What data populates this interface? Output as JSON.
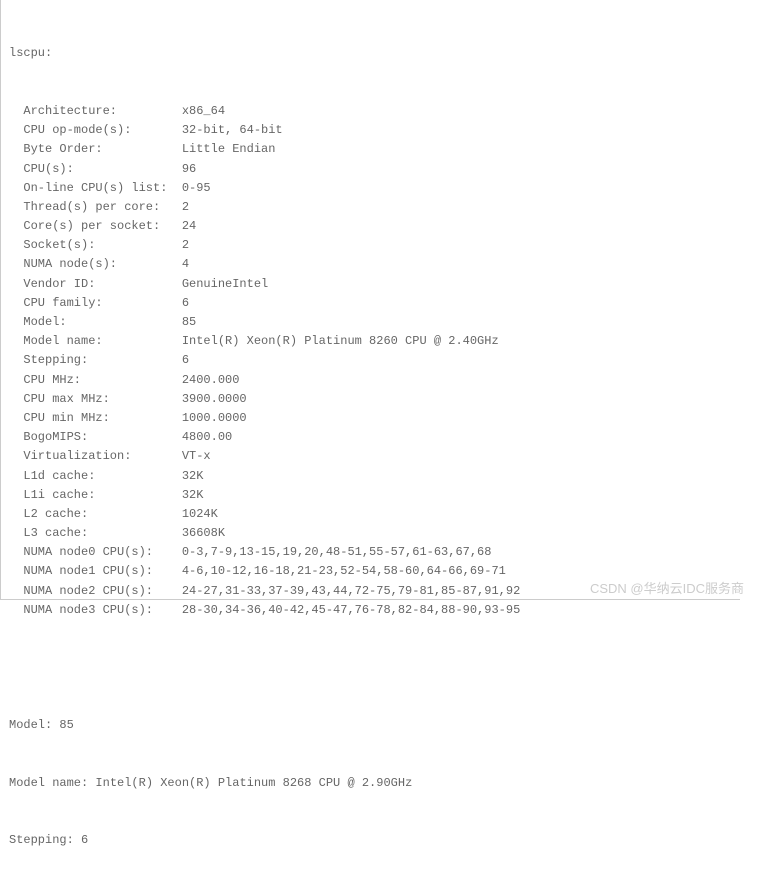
{
  "header": "lscpu:",
  "rows": [
    {
      "label": "Architecture:",
      "value": "x86_64"
    },
    {
      "label": "CPU op-mode(s):",
      "value": "32-bit, 64-bit"
    },
    {
      "label": "Byte Order:",
      "value": "Little Endian"
    },
    {
      "label": "CPU(s):",
      "value": "96"
    },
    {
      "label": "On-line CPU(s) list:",
      "value": "0-95"
    },
    {
      "label": "Thread(s) per core:",
      "value": "2"
    },
    {
      "label": "Core(s) per socket:",
      "value": "24"
    },
    {
      "label": "Socket(s):",
      "value": "2"
    },
    {
      "label": "NUMA node(s):",
      "value": "4"
    },
    {
      "label": "Vendor ID:",
      "value": "GenuineIntel"
    },
    {
      "label": "CPU family:",
      "value": "6"
    },
    {
      "label": "Model:",
      "value": "85"
    },
    {
      "label": "Model name:",
      "value": "Intel(R) Xeon(R) Platinum 8260 CPU @ 2.40GHz"
    },
    {
      "label": "Stepping:",
      "value": "6"
    },
    {
      "label": "CPU MHz:",
      "value": "2400.000"
    },
    {
      "label": "CPU max MHz:",
      "value": "3900.0000"
    },
    {
      "label": "CPU min MHz:",
      "value": "1000.0000"
    },
    {
      "label": "BogoMIPS:",
      "value": "4800.00"
    },
    {
      "label": "Virtualization:",
      "value": "VT-x"
    },
    {
      "label": "L1d cache:",
      "value": "32K"
    },
    {
      "label": "L1i cache:",
      "value": "32K"
    },
    {
      "label": "L2 cache:",
      "value": "1024K"
    },
    {
      "label": "L3 cache:",
      "value": "36608K"
    },
    {
      "label": "NUMA node0 CPU(s):",
      "value": "0-3,7-9,13-15,19,20,48-51,55-57,61-63,67,68"
    },
    {
      "label": "NUMA node1 CPU(s):",
      "value": "4-6,10-12,16-18,21-23,52-54,58-60,64-66,69-71"
    },
    {
      "label": "NUMA node2 CPU(s):",
      "value": "24-27,31-33,37-39,43,44,72-75,79-81,85-87,91,92"
    },
    {
      "label": "NUMA node3 CPU(s):",
      "value": "28-30,34-36,40-42,45-47,76-78,82-84,88-90,93-95"
    }
  ],
  "footer": [
    "Model: 85",
    "Model name: Intel(R) Xeon(R) Platinum 8268 CPU @ 2.90GHz",
    "Stepping: 6"
  ],
  "watermark": "CSDN @华纳云IDC服务商"
}
